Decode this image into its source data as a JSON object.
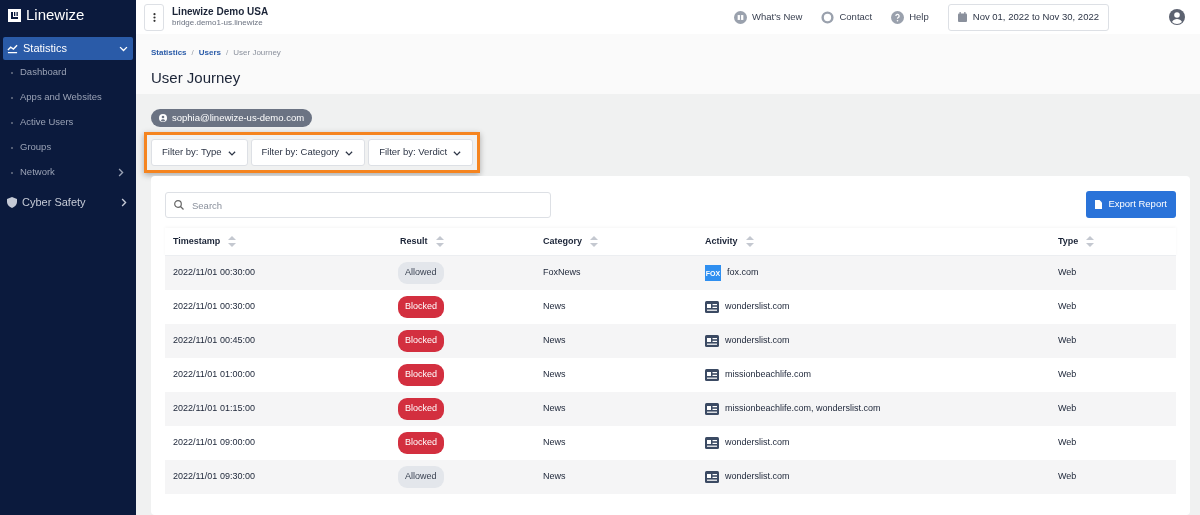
{
  "sidebar": {
    "brand": "Linewize",
    "items": [
      {
        "label": "Statistics",
        "selected": true,
        "expanded": true,
        "children": [
          {
            "label": "Dashboard",
            "has_children": false
          },
          {
            "label": "Apps and Websites",
            "has_children": false
          },
          {
            "label": "Active Users",
            "has_children": false
          },
          {
            "label": "Groups",
            "has_children": false
          },
          {
            "label": "Network",
            "has_children": true
          }
        ]
      },
      {
        "label": "Cyber Safety",
        "selected": false,
        "expanded": false
      }
    ]
  },
  "topbar": {
    "org": "Linewize Demo USA",
    "host": "bridge.demo1-us.linewize",
    "links": [
      "What's New",
      "Contact",
      "Help"
    ],
    "date_range": "Nov 01, 2022 to Nov 30, 2022"
  },
  "breadcrumb": {
    "separator": "/",
    "items": [
      {
        "label": "Statistics",
        "link": true
      },
      {
        "label": "Users",
        "link": true
      },
      {
        "label": "User Journey",
        "link": false
      }
    ]
  },
  "page_title": "User Journey",
  "user_chip": "sophia@linewize-us-demo.com",
  "filters": [
    "Filter by: Type",
    "Filter by: Category",
    "Filter by: Verdict"
  ],
  "search": {
    "placeholder": "Search"
  },
  "export_button": "Export Report",
  "table": {
    "columns": [
      "Timestamp",
      "Result",
      "Category",
      "Activity",
      "Type"
    ],
    "rows": [
      {
        "timestamp": "2022/11/01 00:30:00",
        "result": "Allowed",
        "kind": "allowed",
        "category": "FoxNews",
        "logo": "FOX",
        "activity": "fox.com",
        "type": "Web"
      },
      {
        "timestamp": "2022/11/01 00:30:00",
        "result": "Blocked",
        "kind": "blocked",
        "category": "News",
        "activity": "wonderslist.com",
        "type": "Web"
      },
      {
        "timestamp": "2022/11/01 00:45:00",
        "result": "Blocked",
        "kind": "blocked",
        "category": "News",
        "activity": "wonderslist.com",
        "type": "Web"
      },
      {
        "timestamp": "2022/11/01 01:00:00",
        "result": "Blocked",
        "kind": "blocked",
        "category": "News",
        "activity": "missionbeachlife.com",
        "type": "Web"
      },
      {
        "timestamp": "2022/11/01 01:15:00",
        "result": "Blocked",
        "kind": "blocked",
        "category": "News",
        "activity": "missionbeachlife.com, wonderslist.com",
        "type": "Web"
      },
      {
        "timestamp": "2022/11/01 09:00:00",
        "result": "Blocked",
        "kind": "blocked",
        "category": "News",
        "activity": "wonderslist.com",
        "type": "Web"
      },
      {
        "timestamp": "2022/11/01 09:30:00",
        "result": "Allowed",
        "kind": "allowed",
        "category": "News",
        "activity": "wonderslist.com",
        "type": "Web"
      }
    ]
  }
}
